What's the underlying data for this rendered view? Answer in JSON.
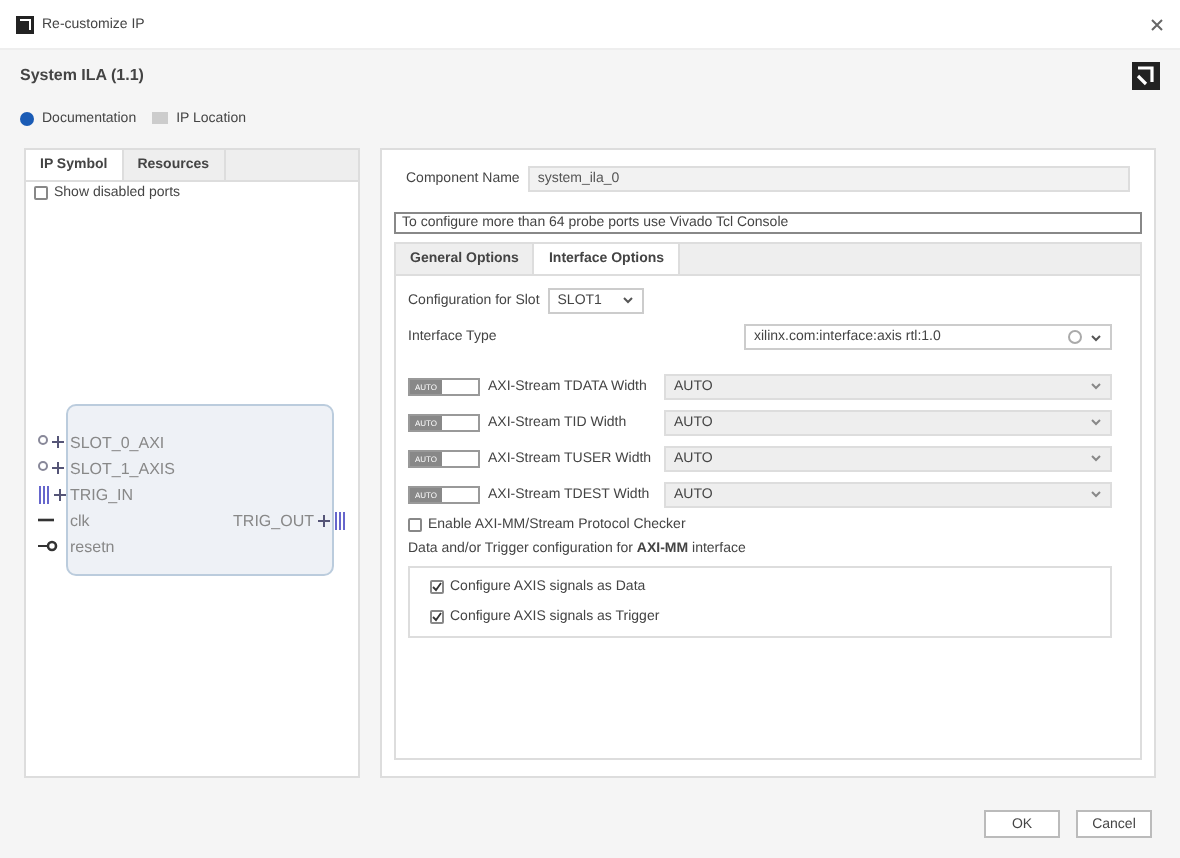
{
  "window": {
    "title": "Re-customize IP"
  },
  "header": {
    "title": "System ILA (1.1)"
  },
  "toolbar": [
    {
      "kind": "info",
      "label": "Documentation"
    },
    {
      "kind": "folder",
      "label": "IP Location"
    }
  ],
  "left_panel": {
    "tabs": [
      {
        "label": "IP Symbol",
        "selected": true
      },
      {
        "label": "Resources",
        "selected": false
      }
    ],
    "show_disabled_ports": {
      "label": "Show disabled ports",
      "checked": false
    },
    "symbol": {
      "left_ports": [
        {
          "kind": "bus",
          "name": "SLOT_0_AXI"
        },
        {
          "kind": "bus",
          "name": "SLOT_1_AXIS"
        },
        {
          "kind": "trigger",
          "name": "TRIG_IN"
        },
        {
          "kind": "clock",
          "name": "clk"
        },
        {
          "kind": "reset",
          "name": "resetn"
        }
      ],
      "right_ports": [
        {
          "kind": "trigger",
          "name": "TRIG_OUT"
        }
      ]
    }
  },
  "right_panel": {
    "component_name": {
      "label": "Component Name",
      "value": "system_ila_0"
    },
    "note": "To configure more than 64 probe ports use Vivado Tcl Console",
    "tabs": [
      {
        "label": "General Options",
        "selected": false
      },
      {
        "label": "Interface Options",
        "selected": true
      }
    ],
    "slot": {
      "label": "Configuration for Slot",
      "value": "SLOT1"
    },
    "interface_type": {
      "label": "Interface Type",
      "value": "xilinx.com:interface:axis rtl:1.0"
    },
    "widths": [
      {
        "toggle": "AUTO",
        "label": "AXI-Stream TDATA Width",
        "value": "AUTO"
      },
      {
        "toggle": "AUTO",
        "label": "AXI-Stream TID Width",
        "value": "AUTO"
      },
      {
        "toggle": "AUTO",
        "label": "AXI-Stream TUSER Width",
        "value": "AUTO"
      },
      {
        "toggle": "AUTO",
        "label": "AXI-Stream TDEST Width",
        "value": "AUTO"
      }
    ],
    "protocol_checker": {
      "label": "Enable AXI-MM/Stream Protocol Checker",
      "checked": false
    },
    "section_title": "Data and/or Trigger configuration for **AXI-MM** interface",
    "options": [
      {
        "label": "Configure AXIS signals as Data",
        "checked": true
      },
      {
        "label": "Configure AXIS signals as Trigger",
        "checked": true
      }
    ]
  },
  "buttons": [
    "OK",
    "Cancel"
  ]
}
